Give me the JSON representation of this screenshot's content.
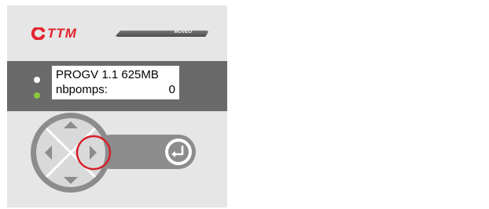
{
  "brand": {
    "name": "TTM",
    "model": "MOVEO"
  },
  "lcd": {
    "line1": "PROGV 1.1 625MB",
    "line2_label": "nbpomps:",
    "line2_value": "0"
  },
  "indicators": [
    {
      "name": "status-led",
      "color": "#ffffff"
    },
    {
      "name": "power-led",
      "color": "#8dc63f"
    }
  ],
  "keypad": {
    "buttons": [
      "up",
      "down",
      "left",
      "right",
      "enter"
    ],
    "highlighted": "right",
    "highlight_color": "#d4202a"
  },
  "colors": {
    "brand_red": "#e3232e",
    "panel": "#e6e6e6",
    "display_band": "#6a6a6a",
    "keypad_gray": "#8c8c8c"
  }
}
